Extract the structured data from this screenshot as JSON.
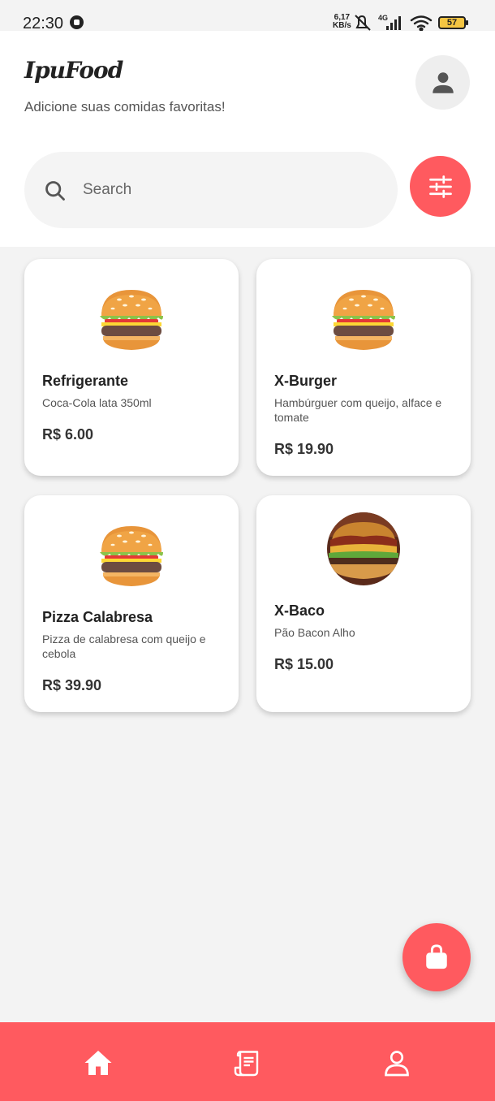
{
  "status_bar": {
    "time": "22:30",
    "speed_value": "6,17",
    "speed_unit": "KB/s",
    "network": "4G",
    "battery": "57"
  },
  "header": {
    "app_name": "IpuFood",
    "subtitle": "Adicione suas comidas favoritas!"
  },
  "search": {
    "placeholder": "Search",
    "value": ""
  },
  "products": [
    {
      "name": "Refrigerante",
      "description": "Coca-Cola lata 350ml",
      "price": "R$ 6.00",
      "image_icon": "burger-emoji"
    },
    {
      "name": "X-Burger",
      "description": "Hambúrguer com queijo, alface e tomate",
      "price": "R$ 19.90",
      "image_icon": "burger-emoji"
    },
    {
      "name": "Pizza Calabresa",
      "description": "Pizza de calabresa com queijo e cebola",
      "price": "R$ 39.90",
      "image_icon": "burger-emoji"
    },
    {
      "name": "X-Baco",
      "description": "Pão Bacon Alho",
      "price": "R$ 15.00",
      "image_icon": "burger-photo"
    }
  ],
  "nav": {
    "items": [
      {
        "icon": "home-icon"
      },
      {
        "icon": "receipt-icon"
      },
      {
        "icon": "user-icon"
      }
    ]
  },
  "colors": {
    "accent": "#ff5a5f",
    "background": "#f3f3f3",
    "card": "#ffffff"
  }
}
